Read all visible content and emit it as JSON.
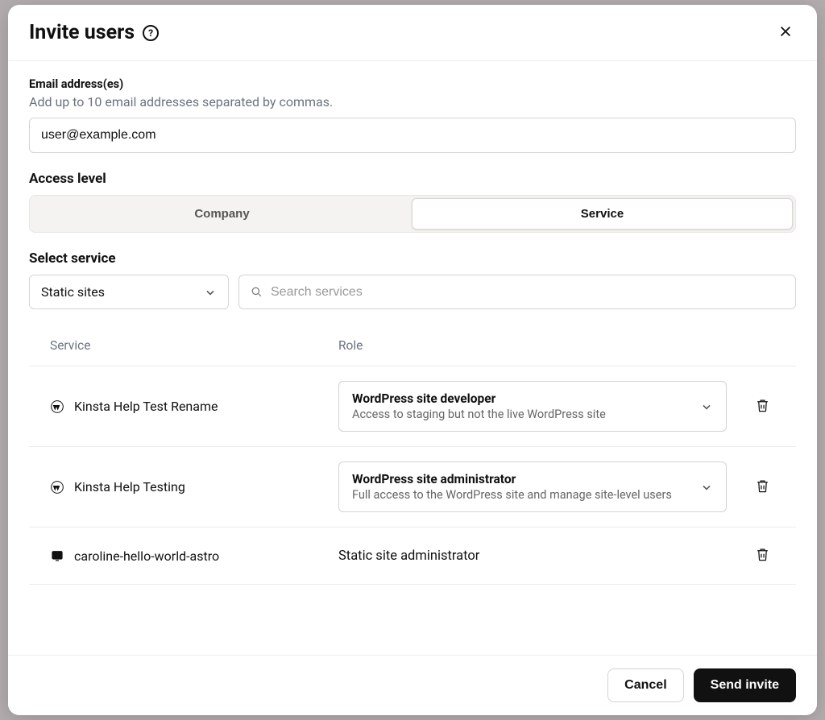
{
  "header": {
    "title": "Invite users",
    "help_glyph": "?"
  },
  "email": {
    "label": "Email address(es)",
    "help": "Add up to 10 email addresses separated by commas.",
    "value": "user@example.com"
  },
  "access_level": {
    "label": "Access level",
    "options": {
      "company": "Company",
      "service": "Service"
    },
    "active": "service"
  },
  "service_filter": {
    "label": "Select service",
    "dropdown_value": "Static sites",
    "search_placeholder": "Search services"
  },
  "table": {
    "columns": {
      "service": "Service",
      "role": "Role"
    },
    "rows": [
      {
        "icon": "wordpress",
        "name": "Kinsta Help Test Rename",
        "role": {
          "title": "WordPress site developer",
          "desc": "Access to staging but not the live WordPress site",
          "type": "select"
        }
      },
      {
        "icon": "wordpress",
        "name": "Kinsta Help Testing",
        "role": {
          "title": "WordPress site administrator",
          "desc": "Full access to the WordPress site and manage site-level users",
          "type": "select"
        }
      },
      {
        "icon": "static",
        "name": "caroline-hello-world-astro",
        "role": {
          "title": "Static site administrator",
          "desc": "",
          "type": "plain"
        }
      }
    ]
  },
  "footer": {
    "cancel": "Cancel",
    "submit": "Send invite"
  }
}
